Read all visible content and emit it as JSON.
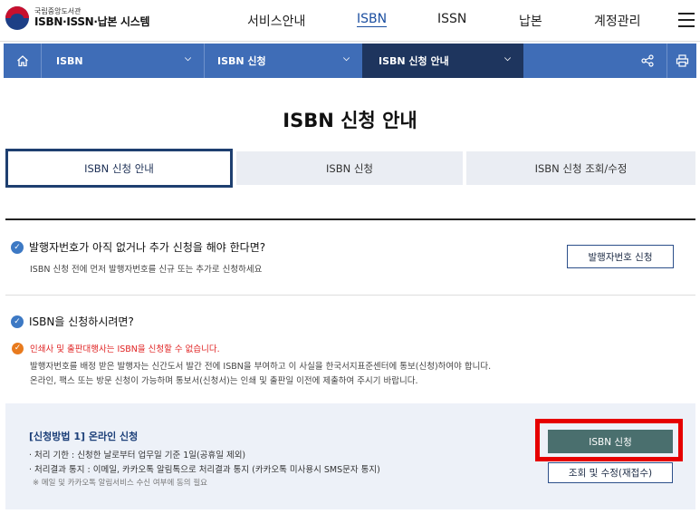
{
  "header": {
    "logo_sub": "국립중앙도서관",
    "logo_main": "ISBN·ISSN·납본 시스템",
    "nav": [
      "서비스안내",
      "ISBN",
      "ISSN",
      "납본",
      "계정관리"
    ]
  },
  "breadcrumb": {
    "level1": "ISBN",
    "level2": "ISBN 신청",
    "level3": "ISBN 신청 안내"
  },
  "page_title": "ISBN 신청 안내",
  "tabs": [
    "ISBN 신청 안내",
    "ISBN 신청",
    "ISBN 신청 조회/수정"
  ],
  "section1": {
    "question": "발행자번호가 아직 없거나 추가 신청을 해야 한다면?",
    "description": "ISBN 신청 전에 먼저 발행자번호를 신규 또는 추가로 신청하세요",
    "button": "발행자번호 신청"
  },
  "section2": {
    "question": "ISBN을 신청하시려면?",
    "warning": "인쇄사 및 출판대행사는 ISBN을 신청할 수 없습니다.",
    "line1": "발행자번호를 배정 받은 발행자는 신간도서 발간 전에 ISBN을 부여하고 이 사실을 한국서지표준센터에 통보(신청)하여야 합니다.",
    "line2": "온라인, 팩스 또는 방문 신청이 가능하며 통보서(신청서)는 인쇄 및 출판일 이전에 제출하여 주시기 바랍니다."
  },
  "method1": {
    "title": "[신청방법 1] 온라인 신청",
    "item1": "· 처리 기한 : 신청한 날로부터 업무일 기준 1일(공휴일 제외)",
    "item2": "· 처리결과 통지 : 이메일, 카카오톡 알림톡으로 처리결과 통지 (카카오톡 미사용시 SMS문자 통지)",
    "note": "※ 메일 및 카카오톡 알림서비스 수신 여부에 동의 필요",
    "apply_button": "ISBN 신청",
    "edit_button": "조회 및 수정(재접수)"
  },
  "colors": {
    "accent": "#3f6db7",
    "breadcrumb_active": "#1e355e",
    "apply_button": "#4a6f6e",
    "highlight_box": "#e60000",
    "warning_text": "#e02424"
  }
}
